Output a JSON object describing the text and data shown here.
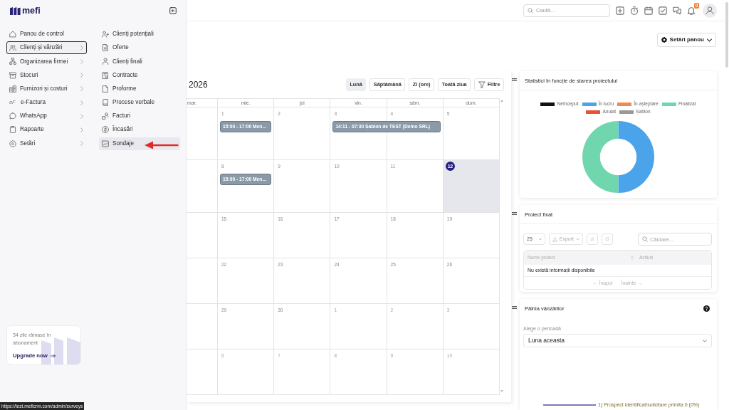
{
  "sidebar": {
    "logo": "mefi",
    "menu": [
      {
        "label": "Panou de control",
        "selected": false,
        "has_submenu": false
      },
      {
        "label": "Clienți și vânzări",
        "selected": true,
        "has_submenu": true
      },
      {
        "label": "Organizarea firmei",
        "selected": false,
        "has_submenu": true
      },
      {
        "label": "Stocuri",
        "selected": false,
        "has_submenu": true
      },
      {
        "label": "Furnizori și costuri",
        "selected": false,
        "has_submenu": true
      },
      {
        "label": "e-Factura",
        "icon_text": "eF",
        "selected": false,
        "has_submenu": true
      },
      {
        "label": "WhatsApp",
        "selected": false,
        "has_submenu": true
      },
      {
        "label": "Rapoarte",
        "selected": false,
        "has_submenu": true
      },
      {
        "label": "Setări",
        "selected": false,
        "has_submenu": true
      }
    ],
    "submenu": [
      {
        "label": "Clienți potențiali",
        "hovered": false
      },
      {
        "label": "Oferte",
        "hovered": false
      },
      {
        "label": "Clienți finali",
        "hovered": false
      },
      {
        "label": "Contracte",
        "hovered": false
      },
      {
        "label": "Proforme",
        "hovered": false
      },
      {
        "label": "Procese verbale",
        "hovered": false
      },
      {
        "label": "Facturi",
        "hovered": false
      },
      {
        "label": "Încasări",
        "hovered": false
      },
      {
        "label": "Sondaje",
        "hovered": true
      }
    ],
    "subscription": {
      "text": "34 zile rămase în abonament",
      "link": "Upgrade now"
    }
  },
  "topbar": {
    "search": {
      "placeholder": "Caută..."
    },
    "notification_badge": "0"
  },
  "panel_settings_button": "Setări panou",
  "calendar": {
    "title": "2026",
    "views": [
      {
        "label": "Lună",
        "selected": true
      },
      {
        "label": "Săptămână",
        "selected": false
      },
      {
        "label": "Zi (ore)",
        "selected": false
      },
      {
        "label": "Toată ziua",
        "selected": false
      }
    ],
    "filter_button": "Filtre",
    "weekdays": [
      "mar.",
      "mie.",
      "joi",
      "vin.",
      "sâm.",
      "dum."
    ],
    "weeks": [
      {
        "days": [
          {
            "label": "1",
            "muted": false,
            "today": false,
            "events": [
              {
                "text": "15:00 - 17:00 Men...",
                "multi_day": false
              }
            ]
          },
          {
            "label": "2",
            "muted": false,
            "today": false
          },
          {
            "label": "3",
            "muted": false,
            "today": false,
            "events": [
              {
                "text": "14:11 - 07:30 Șablon de TEST (Demo SRL)",
                "multi_day": true
              }
            ]
          },
          {
            "label": "4",
            "muted": false,
            "today": false
          },
          {
            "label": "5",
            "muted": false,
            "today": false
          }
        ]
      },
      {
        "days": [
          {
            "label": "8",
            "muted": false,
            "today": false,
            "events": [
              {
                "text": "15:00 - 17:00 Men...",
                "multi_day": false
              }
            ]
          },
          {
            "label": "9",
            "muted": false,
            "today": false
          },
          {
            "label": "10",
            "muted": false,
            "today": false
          },
          {
            "label": "11",
            "muted": false,
            "today": false
          },
          {
            "label": "12",
            "muted": false,
            "today": true
          }
        ]
      },
      {
        "days": [
          {
            "label": "15",
            "muted": false,
            "today": false
          },
          {
            "label": "16",
            "muted": false,
            "today": false
          },
          {
            "label": "17",
            "muted": false,
            "today": false
          },
          {
            "label": "18",
            "muted": false,
            "today": false
          },
          {
            "label": "19",
            "muted": false,
            "today": false
          }
        ]
      },
      {
        "days": [
          {
            "label": "22",
            "muted": false,
            "today": false
          },
          {
            "label": "23",
            "muted": false,
            "today": false
          },
          {
            "label": "24",
            "muted": false,
            "today": false
          },
          {
            "label": "25",
            "muted": false,
            "today": false
          },
          {
            "label": "26",
            "muted": false,
            "today": false
          }
        ]
      },
      {
        "days": [
          {
            "label": "29",
            "muted": false,
            "today": false
          },
          {
            "label": "30",
            "muted": false,
            "today": false
          },
          {
            "label": "1",
            "muted": true,
            "today": false
          },
          {
            "label": "2",
            "muted": true,
            "today": false
          },
          {
            "label": "3",
            "muted": true,
            "today": false
          }
        ]
      },
      {
        "days": [
          {
            "label": "6",
            "muted": true,
            "today": false
          },
          {
            "label": "7",
            "muted": true,
            "today": false
          },
          {
            "label": "8",
            "muted": true,
            "today": false
          },
          {
            "label": "9",
            "muted": true,
            "today": false
          },
          {
            "label": "10",
            "muted": true,
            "today": false
          }
        ]
      }
    ]
  },
  "project_status_card": {
    "title": "Statistici în funcție de starea proiectului",
    "legend": [
      {
        "label": "Neînceput",
        "color": "#111111"
      },
      {
        "label": "În lucru",
        "color": "#4ba3ea"
      },
      {
        "label": "În așteptare",
        "color": "#ee8a55"
      },
      {
        "label": "Finalizat",
        "color": "#6fd6ae"
      },
      {
        "label": "Anulat",
        "color": "#e5533d"
      },
      {
        "label": "Șablon",
        "color": "#999999"
      }
    ]
  },
  "pinned_project_card": {
    "title": "Proiect fixat",
    "page_size": "25",
    "export_button": "Export",
    "search": {
      "placeholder": "Căutare..."
    },
    "columns": [
      "Nume proiect",
      "Acțiuni"
    ],
    "empty_message": "Nu există informații disponibile",
    "previous_button": "← Înapoi",
    "next_button": "Înainte →"
  },
  "sales_funnel_card": {
    "title": "Pâlnia vânzărilor",
    "period": {
      "label": "Alege o perioadă",
      "value": "Luna aceasta"
    },
    "stages": [
      {
        "label": "1) Prospect identificat/solicitare primita 0 (0%)"
      }
    ]
  },
  "status_url": "https://test.meficrm.com/admin/surveys"
}
